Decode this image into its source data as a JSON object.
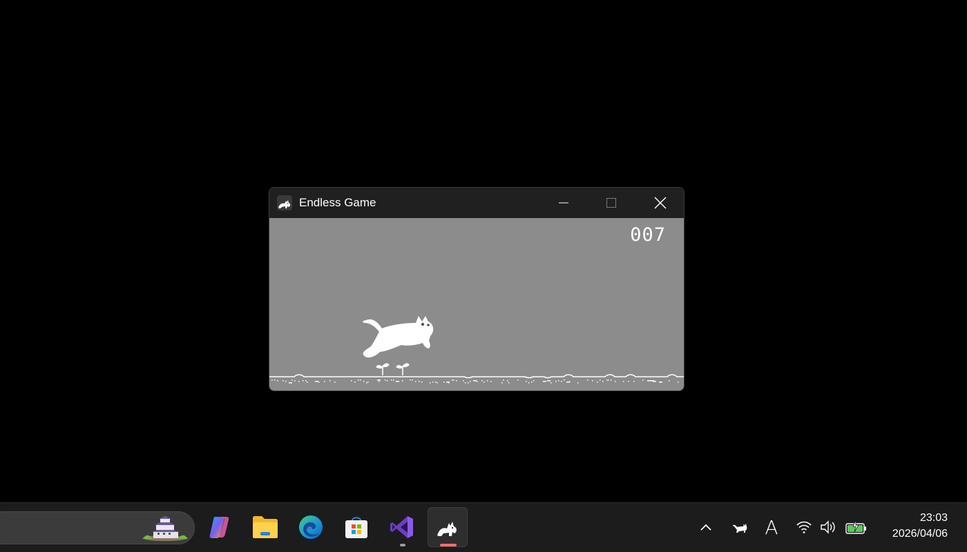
{
  "window": {
    "title": "Endless Game",
    "app_icon": "cat-icon",
    "controls": [
      "minimize-icon",
      "maximize-icon",
      "close-icon"
    ]
  },
  "game": {
    "score": "007",
    "colors": {
      "background": "#8c8c8c",
      "foreground": "#ffffff"
    }
  },
  "taskbar": {
    "pinned_apps": [
      "copilot-icon",
      "file-explorer-icon",
      "edge-icon",
      "microsoft-store-icon",
      "visual-studio-icon",
      "endless-game-icon"
    ],
    "tray_icons": [
      "show-hidden-icons-chevron",
      "cat-tray-icon",
      "ime-indicator-icon",
      "wifi-icon",
      "volume-icon",
      "battery-charging-icon"
    ],
    "ime_label": "A",
    "clock": {
      "time": "23:03",
      "date": "2026/04/06"
    },
    "colors": {
      "active_indicator": "#f07070",
      "running_indicator": "#9a9a9a"
    }
  }
}
